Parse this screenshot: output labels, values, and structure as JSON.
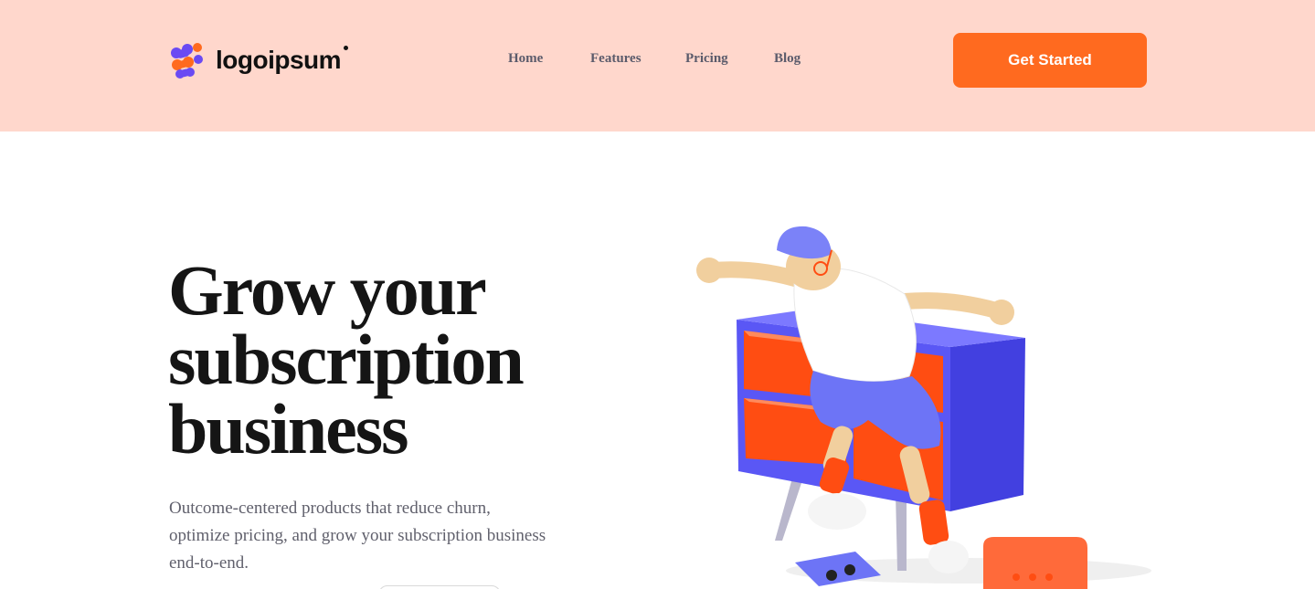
{
  "header": {
    "logo_text": "logoipsum",
    "nav": [
      {
        "label": "Home"
      },
      {
        "label": "Features"
      },
      {
        "label": "Pricing"
      },
      {
        "label": "Blog"
      }
    ],
    "cta_label": "Get Started"
  },
  "hero": {
    "title": "Grow your subscription business",
    "subtitle": "Outcome-centered products that reduce churn, optimize pricing, and grow your subscription business end-to-end."
  },
  "colors": {
    "header_bg": "#ffd7cc",
    "accent": "#ff6a1f",
    "shelf_purple": "#5a57f5",
    "shelf_orange": "#ff4d12",
    "heading": "#151515",
    "body_text": "#60606c"
  },
  "icons": {
    "logo": "logo-mark-icon",
    "hero_image": "skater-illustration"
  }
}
